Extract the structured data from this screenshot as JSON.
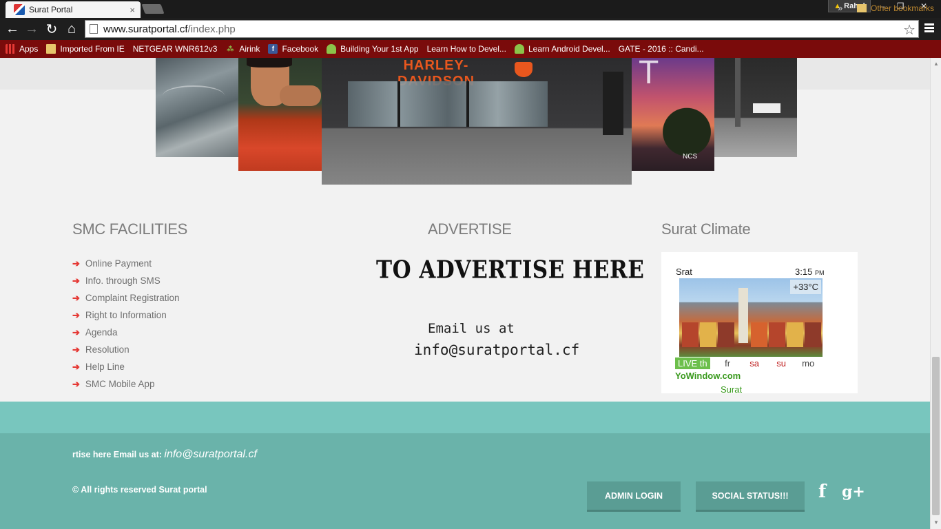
{
  "browser": {
    "tab_title": "Surat Portal",
    "tab_close": "×",
    "profile_name": "Rahul",
    "url_host": "www.suratportal.cf",
    "url_path": "/index.php",
    "window_controls": [
      "–",
      "❐",
      "✕"
    ]
  },
  "bookmarks": [
    {
      "label": "Apps",
      "icon": "apps-icon"
    },
    {
      "label": "Imported From IE",
      "icon": "folder-icon"
    },
    {
      "label": "NETGEAR WNR612v3",
      "icon": "page-icon"
    },
    {
      "label": "Airink",
      "icon": "airink-icon"
    },
    {
      "label": "Facebook",
      "icon": "facebook-icon"
    },
    {
      "label": "Building Your 1st App",
      "icon": "android-icon"
    },
    {
      "label": "Learn How to Devel...",
      "icon": "page-icon"
    },
    {
      "label": "Learn Android Devel...",
      "icon": "android-icon"
    },
    {
      "label": "GATE - 2016 :: Candi...",
      "icon": "page-icon"
    }
  ],
  "bookmarks_other": "Other bookmarks",
  "bookmarks_more": "»",
  "carousel": {
    "harley_sign": "HARLEY-DAVIDSON",
    "ncs_label": "NCS"
  },
  "facilities": {
    "title": "SMC FACILITIES",
    "items": [
      "Online Payment",
      "Info. through SMS",
      "Complaint Registration",
      "Right to Information",
      "Agenda",
      "Resolution",
      "Help Line",
      "SMC Mobile App"
    ]
  },
  "advertise": {
    "title": "ADVERTISE",
    "headline": "TO ADVERTISE HERE",
    "email_label": "Email us at",
    "email": "info@suratportal.cf"
  },
  "climate": {
    "title": "Surat Climate",
    "city": "Srat",
    "time": "3:15",
    "time_suffix": "PM",
    "temperature": "+33°C",
    "live_label": "LIVE th",
    "days": [
      "fr",
      "sa",
      "su",
      "mo"
    ],
    "brand": "YoWindow.com",
    "place": "Surat"
  },
  "footer": {
    "marquee_text": "rtise here Email us at: ",
    "marquee_email": "info@suratportal.cf",
    "copyright": "© All rights reserved Surat portal",
    "admin_login": "ADMIN LOGIN",
    "social_status": "SOCIAL STATUS!!!",
    "facebook_glyph": "f",
    "gplus_glyph": "g+"
  },
  "colors": {
    "bookmark_bar": "#7a0b0b",
    "footer_light": "#78c6be",
    "footer_dark": "#6ab3aa",
    "arrow_accent": "#e53935"
  }
}
